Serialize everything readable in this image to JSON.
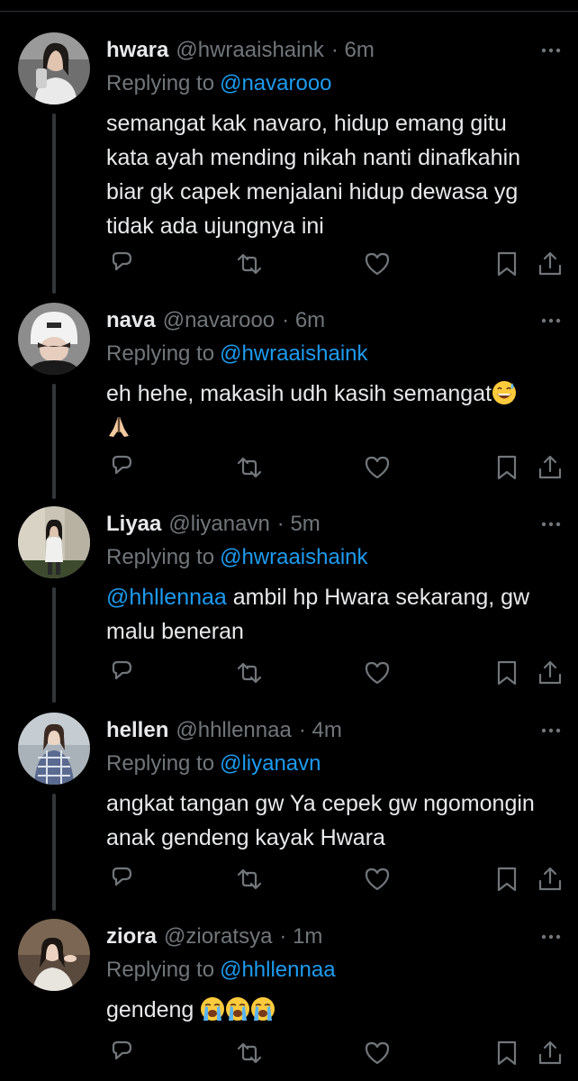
{
  "colors": {
    "background": "#000000",
    "text": "#e7e9ea",
    "muted": "#71767b",
    "link": "#1d9bf0"
  },
  "labels": {
    "replying_to": "Replying to"
  },
  "tweets": [
    {
      "name": "hwara",
      "handle": "@hwraaishaink",
      "time": "· 6m",
      "replying_to": "@navarooo",
      "lines": [
        "semangat kak navaro, hidup emang gitu",
        "kata ayah mending nikah nanti dinafkahin",
        "biar gk capek menjalani hidup dewasa yg",
        "tidak ada ujungnya ini"
      ],
      "emoji": []
    },
    {
      "name": "nava",
      "handle": "@navarooo",
      "time": "· 6m",
      "replying_to": "@hwraaishaink",
      "lines": [
        "eh hehe, makasih udh kasih semangat"
      ],
      "emoji": [
        "grinning-sweat-emoji",
        "folded-hands-emoji"
      ]
    },
    {
      "name": "Liyaa",
      "handle": "@liyanavn",
      "time": "· 5m",
      "replying_to": "@hwraaishaink",
      "mention_in_body": "@hhllennaa",
      "lines": [
        "ambil hp Hwara sekarang, gw",
        "malu beneran"
      ],
      "emoji": []
    },
    {
      "name": "hellen",
      "handle": "@hhllennaa",
      "time": "· 4m",
      "replying_to": "@liyanavn",
      "lines": [
        "angkat tangan gw Ya cepek gw ngomongin",
        "anak gendeng kayak Hwara"
      ],
      "emoji": []
    },
    {
      "name": "ziora",
      "handle": "@zioratsya",
      "time": "· 1m",
      "replying_to": "@hhllennaa",
      "lines": [
        "gendeng"
      ],
      "emoji": [
        "loudly-crying-emoji",
        "loudly-crying-emoji",
        "loudly-crying-emoji"
      ]
    }
  ]
}
